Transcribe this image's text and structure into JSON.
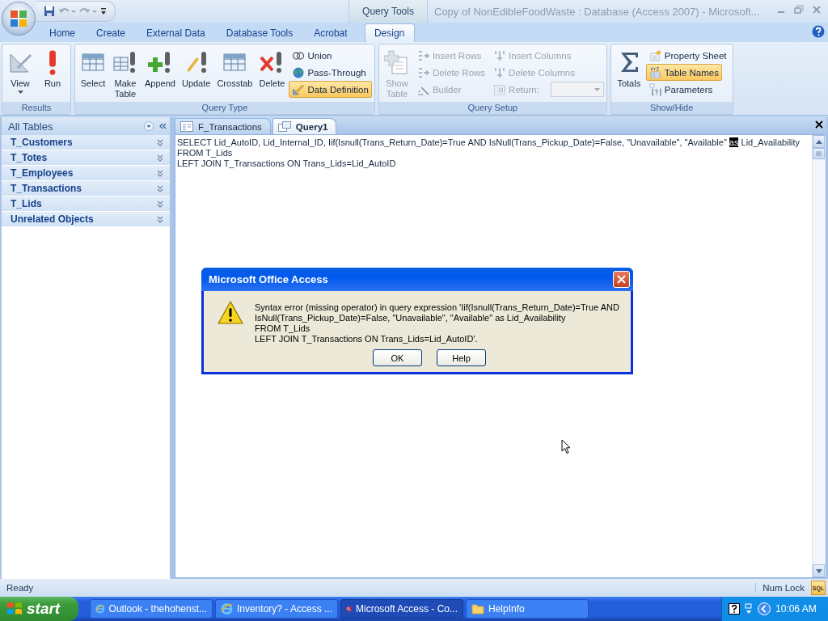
{
  "window": {
    "title": "Copy of NonEdibleFoodWaste : Database (Access 2007) - Microsoft...",
    "context_label": "Query Tools"
  },
  "ribbon_tabs": [
    {
      "label": "Home",
      "selected": false
    },
    {
      "label": "Create",
      "selected": false
    },
    {
      "label": "External Data",
      "selected": false
    },
    {
      "label": "Database Tools",
      "selected": false
    },
    {
      "label": "Acrobat",
      "selected": false
    },
    {
      "label": "Design",
      "selected": true
    }
  ],
  "ribbon_groups": [
    {
      "label": "Results",
      "columns": [
        {
          "kind": "large",
          "items": [
            {
              "label": "View",
              "disabled": false,
              "selected": false,
              "dropdown": true
            }
          ]
        },
        {
          "kind": "large",
          "items": [
            {
              "label": "Run",
              "disabled": false,
              "selected": false
            }
          ]
        }
      ]
    },
    {
      "label": "Query Type",
      "columns": [
        {
          "kind": "large",
          "items": [
            {
              "label": "Select",
              "disabled": false,
              "selected": false
            }
          ]
        },
        {
          "kind": "large",
          "items": [
            {
              "label": "Make Table",
              "disabled": false,
              "selected": false
            }
          ]
        },
        {
          "kind": "large",
          "items": [
            {
              "label": "Append",
              "disabled": false,
              "selected": false
            }
          ]
        },
        {
          "kind": "large",
          "items": [
            {
              "label": "Update",
              "disabled": false,
              "selected": false
            }
          ]
        },
        {
          "kind": "large",
          "items": [
            {
              "label": "Crosstab",
              "disabled": false,
              "selected": false
            }
          ]
        },
        {
          "kind": "large",
          "items": [
            {
              "label": "Delete",
              "disabled": false,
              "selected": false
            }
          ]
        },
        {
          "kind": "stack",
          "items": [
            {
              "label": "Union",
              "disabled": false,
              "selected": false
            },
            {
              "label": "Pass-Through",
              "disabled": false,
              "selected": false
            },
            {
              "label": "Data Definition",
              "disabled": false,
              "selected": true
            }
          ]
        }
      ]
    },
    {
      "label": "Query Setup",
      "columns": [
        {
          "kind": "large",
          "items": [
            {
              "label": "Show Table",
              "disabled": true,
              "selected": false
            }
          ]
        },
        {
          "kind": "stack",
          "items": [
            {
              "label": "Insert Rows",
              "disabled": true,
              "selected": false
            },
            {
              "label": "Delete Rows",
              "disabled": true,
              "selected": false
            },
            {
              "label": "Builder",
              "disabled": true,
              "selected": false
            }
          ]
        },
        {
          "kind": "stack",
          "items": [
            {
              "label": "Insert Columns",
              "disabled": true,
              "selected": false
            },
            {
              "label": "Delete Columns",
              "disabled": true,
              "selected": false
            },
            {
              "label": "Return:",
              "disabled": true,
              "selected": false,
              "combo": true
            }
          ]
        }
      ]
    },
    {
      "label": "Show/Hide",
      "columns": [
        {
          "kind": "large",
          "items": [
            {
              "label": "Totals",
              "disabled": false,
              "selected": false
            }
          ]
        },
        {
          "kind": "stack",
          "items": [
            {
              "label": "Property Sheet",
              "disabled": false,
              "selected": false
            },
            {
              "label": "Table Names",
              "disabled": false,
              "selected": true
            },
            {
              "label": "Parameters",
              "disabled": false,
              "selected": false
            }
          ]
        }
      ]
    }
  ],
  "nav_pane": {
    "header": "All Tables",
    "groups": [
      {
        "label": "T_Customers",
        "expanded": false
      },
      {
        "label": "T_Totes",
        "expanded": false
      },
      {
        "label": "T_Employees",
        "expanded": false
      },
      {
        "label": "T_Transactions",
        "expanded": false
      },
      {
        "label": "T_Lids",
        "expanded": false
      },
      {
        "label": "Unrelated Objects",
        "expanded": false
      }
    ]
  },
  "document_tabs": [
    {
      "label": "F_Transactions",
      "selected": false
    },
    {
      "label": "Query1",
      "selected": true
    }
  ],
  "sql_editor": {
    "lines": [
      [
        {
          "text": "SELECT Lid_AutoID, Lid_Internal_ID, Iif(Isnull(Trans_Return_Date)=True AND IsNull(Trans_Pickup_Date)=False, \"Unavailable\", \"Available\" ",
          "selected": false
        },
        {
          "text": "as",
          "selected": true
        },
        {
          "text": " Lid_Availability",
          "selected": false
        }
      ],
      [
        {
          "text": "FROM T_Lids",
          "selected": false
        }
      ],
      [
        {
          "text": "LEFT JOIN T_Transactions ON Trans_Lids=Lid_AutoID",
          "selected": false
        }
      ]
    ]
  },
  "dialog": {
    "title": "Microsoft Office Access",
    "message": "Syntax error (missing operator) in query expression 'Iif(Isnull(Trans_Return_Date)=True AND\nIsNull(Trans_Pickup_Date)=False, \"Unavailable\", \"Available\" as Lid_Availability\nFROM T_Lids\nLEFT JOIN T_Transactions ON Trans_Lids=Lid_AutoID'.",
    "buttons": [
      "OK",
      "Help"
    ]
  },
  "status_bar": {
    "text": "Ready",
    "indicator": "Num Lock",
    "view_button": "SQL"
  },
  "taskbar": {
    "start": "start",
    "tasks": [
      {
        "label": "Outlook - thehohenst...",
        "kind": "browser",
        "selected": false
      },
      {
        "label": "Inventory? - Access ...",
        "kind": "browser",
        "selected": false
      },
      {
        "label": "Microsoft Access - Co...",
        "kind": "access",
        "selected": true
      },
      {
        "label": "HelpInfo",
        "kind": "folder",
        "selected": false
      }
    ],
    "clock": "10:06 AM"
  }
}
